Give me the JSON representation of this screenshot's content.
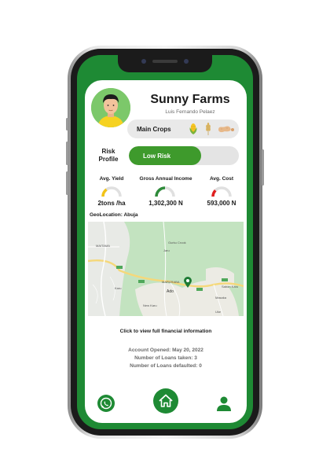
{
  "profile": {
    "farm_name": "Sunny Farms",
    "owner_name": "Luis Fernando Pelaez"
  },
  "crops": {
    "label": "Main Crops",
    "icons": [
      "corn-icon",
      "wheat-icon",
      "peanut-icon"
    ]
  },
  "risk": {
    "label": "Risk Profile",
    "level_text": "Low Risk",
    "fill_fraction": 0.66,
    "color": "#3e9a2c"
  },
  "metrics": [
    {
      "title": "Avg. Yield",
      "value": "2tons /ha",
      "level": 0.3,
      "color": "#f2c318"
    },
    {
      "title": "Gross Annual Income",
      "value": "1,302,300 N",
      "level": 0.5,
      "color": "#2e8b3a"
    },
    {
      "title": "Avg. Cost",
      "value": "593,000 N",
      "level": 0.25,
      "color": "#e02020"
    }
  ],
  "geo": {
    "label": "GeoLocation: Abuja",
    "places": [
      "MAITAMA",
      "Ado",
      "Karu",
      "New Karu",
      "MARARABA",
      "Gurku Crook",
      "Jaru",
      "Sabon Karu",
      "Masaka",
      "Uke"
    ]
  },
  "links": {
    "financial": "Click to view full financial information"
  },
  "account": {
    "opened": "Account Opened: May 20, 2022",
    "loans_taken": "Number of Loans taken: 3",
    "loans_defaulted": "Number of Loans defaulted: 0"
  },
  "nav": {
    "icons": [
      "whatsapp-icon",
      "home-icon",
      "user-icon"
    ]
  },
  "colors": {
    "brand": "#1e8a34",
    "accent": "#3e9a2c"
  }
}
